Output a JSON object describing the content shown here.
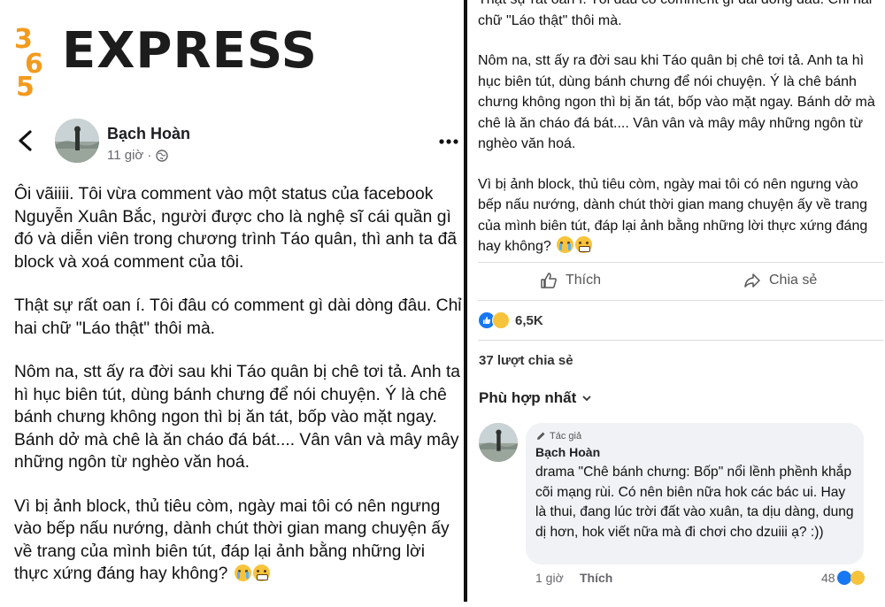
{
  "logo": {
    "mark_text": "365",
    "wordmark": "EXPRESS"
  },
  "left": {
    "author": "Bạch Hoàn",
    "time": "11 giờ ·",
    "paragraphs": [
      "Ôi vãiiii. Tôi vừa comment vào một status của facebook Nguyễn Xuân Bắc, người được cho là nghệ sĩ cái quần gì đó và diễn viên trong chương trình Táo quân, thì anh ta đã block và xoá comment của tôi.",
      "Thật sự rất oan í. Tôi đâu có comment gì dài dòng đâu. Chỉ hai chữ \"Láo thật\" thôi mà.",
      "Nôm na, stt ấy ra đời sau khi Táo quân bị chê tơi tả. Anh ta hì hục biên tút, dùng bánh chưng để nói chuyện. Ý là chê bánh chưng không ngon thì bị ăn tát, bốp vào mặt ngay. Bánh dở mà chê là ăn cháo đá bát.... Vân vân và mây mây những ngôn từ nghèo văn hoá.",
      "Vì bị ảnh block, thủ tiêu còm, ngày mai tôi có nên ngưng vào bếp nấu nướng, dành chút thời gian mang chuyện ấy về trang của mình biên tút, đáp lại ảnh bằng những lời thực xứng đáng hay không?"
    ]
  },
  "right": {
    "paragraphs": [
      "Thật sự rất oan í. Tôi đâu có comment gì dài dòng đâu. Chỉ hai chữ \"Láo thật\" thôi mà.",
      "Nôm na, stt ấy ra đời sau khi Táo quân bị chê tơi tả. Anh ta hì hục biên tút, dùng bánh chưng để nói chuyện. Ý là chê bánh chưng không ngon thì bị ăn tát, bốp vào mặt ngay. Bánh dở mà chê là ăn cháo đá bát.... Vân vân và mây mây những ngôn từ nghèo văn hoá.",
      "Vì bị ảnh block, thủ tiêu còm, ngày mai tôi có nên ngưng vào bếp nấu nướng, dành chút thời gian mang chuyện ấy về trang của mình biên tút, đáp lại ảnh bằng những lời thực xứng đáng hay không?"
    ],
    "like_label": "Thích",
    "share_label": "Chia sẻ",
    "reaction_count": "6,5K",
    "share_count": "37 lượt chia sẻ",
    "sort_label": "Phù hợp nhất",
    "comment": {
      "badge": "Tác giả",
      "author": "Bạch Hoàn",
      "text": "drama \"Chê bánh chưng: Bốp\" nổi lềnh phềnh khắp cõi mạng rùi. Có nên biên nữa hok các bác ui. Hay là thui, đang lúc trời đất vào xuân, ta dịu dàng, dung dị hơn, hok viết nữa mà đi chơi cho dzuiii ạ? :))",
      "time": "1 giờ",
      "like": "Thích",
      "reaction_count": "48"
    }
  },
  "colors": {
    "facebook_blue": "#1877f2",
    "logo_orange": "#f39a1e",
    "secondary_text": "#65676b"
  }
}
